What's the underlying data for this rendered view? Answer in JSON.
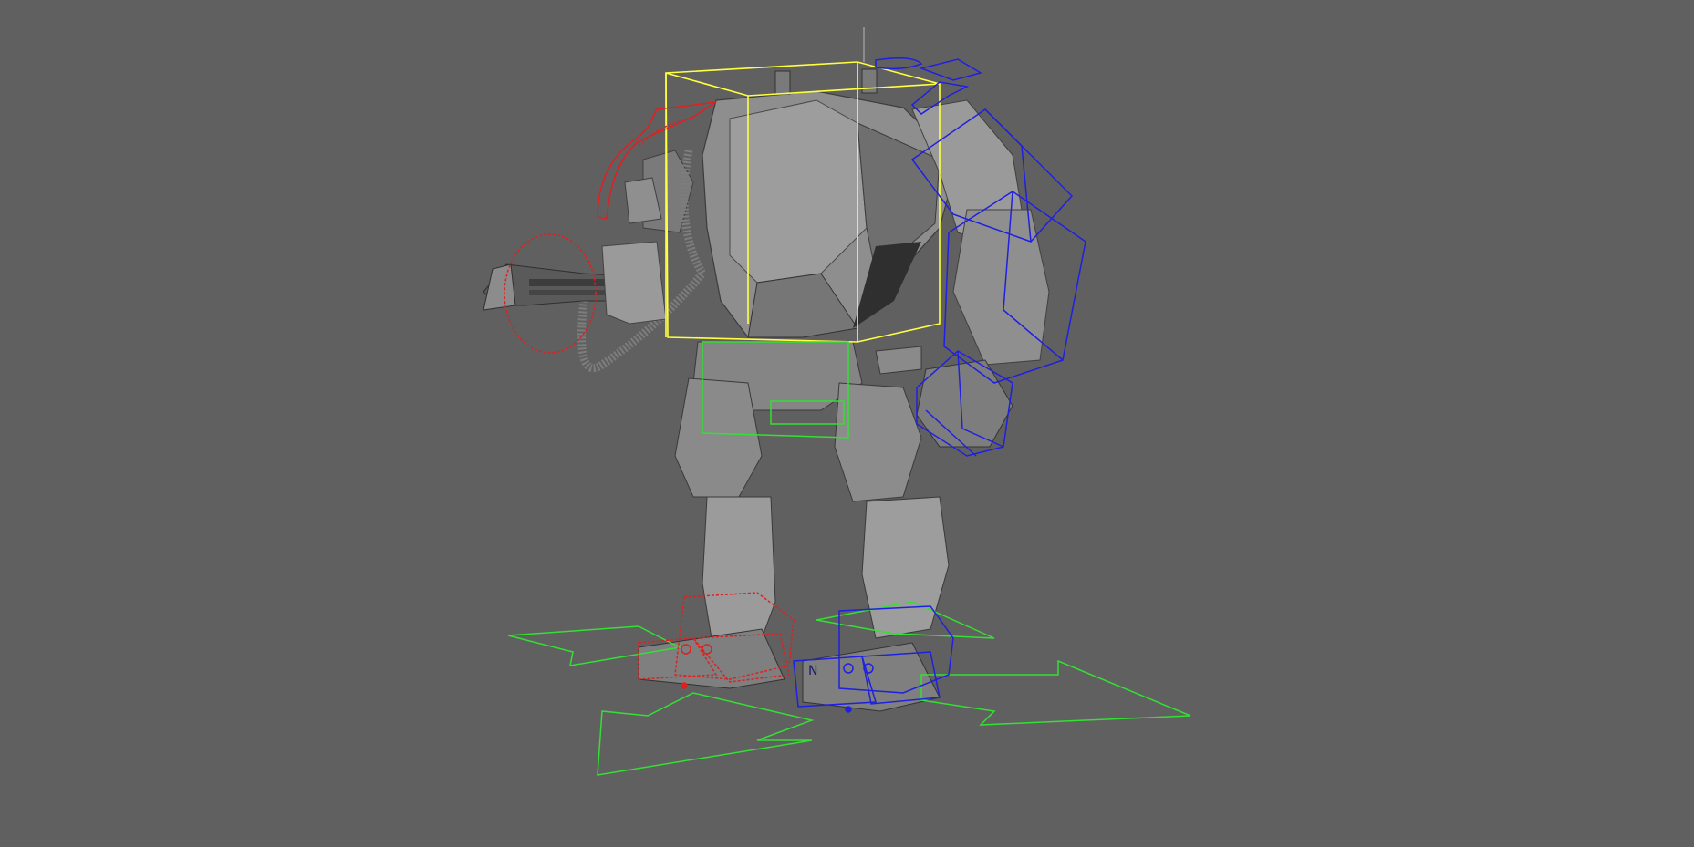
{
  "viewport": {
    "background_color": "#606060",
    "model_shade": "#8a8a8a",
    "model_dark": "#3a3a3a",
    "model_light": "#b5b5b5"
  },
  "rig_controls": {
    "torso_box_color": "#ffff40",
    "hip_box_color": "#33e033",
    "left_side_color": "#e02020",
    "right_side_color": "#2020e0",
    "root_arrows_color": "#33e033"
  },
  "icons": {
    "weapon_circle": "circle-control-icon",
    "shoulder_arrow": "curved-arrow-icon"
  },
  "labels": {
    "foot_marker": "N"
  }
}
